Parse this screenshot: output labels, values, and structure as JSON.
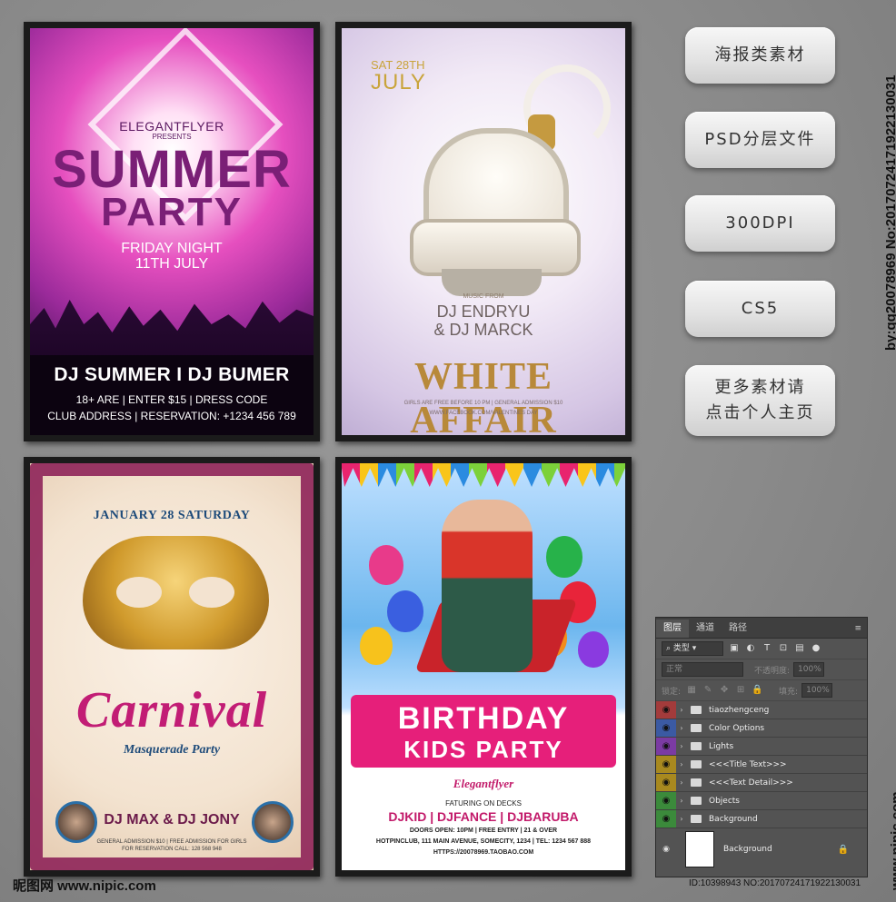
{
  "poster1": {
    "brand": "ELEGANTFLYER",
    "presents": "PRESENTS",
    "title1": "SUMMER",
    "title2": "PARTY",
    "date1": "FRIDAY NIGHT",
    "date2": "11TH JULY",
    "djs": "DJ SUMMER I DJ BUMER",
    "info1": "18+ ARE | ENTER $15 | DRESS CODE",
    "info2": "CLUB ADDRESS | RESERVATION: +1234 456 789"
  },
  "poster2": {
    "date_day": "SAT 28TH",
    "date_month": "JULY",
    "music_from": "MUSIC FROM",
    "dj1": "DJ ENDRYU",
    "dj2": "& DJ MARCK",
    "title": "WHITE AFFAIR",
    "small1": "GIRLS ARE FREE BEFORE 10 PM | GENERAL ADMISSION $10",
    "small2": "WWW.FACEBOOK.COM/VALENTINES DAY"
  },
  "poster3": {
    "date": "JANUARY 28 SATURDAY",
    "title": "Carnival",
    "subtitle": "Masquerade Party",
    "djs": "DJ MAX   &   DJ JONY",
    "info1": "GENERAL ADMISSION $10 | FREE ADMISSION FOR GIRLS",
    "info2": "FOR RESERVATION CALL: 128 568 948"
  },
  "poster4": {
    "title1": "BIRTHDAY",
    "title2": "KIDS PARTY",
    "brand": "Elegantflyer",
    "featuring": "FATURING ON DECKS",
    "djs": "DJKID | DJFANCE | DJBARUBA",
    "line1": "DOORS OPEN: 10PM | FREE ENTRY | 21 & OVER",
    "line2": "HOTPINCLUB, 111 MAIN AVENUE, SOMECITY, 1234 | TEL: 1234 567 888",
    "line3": "HTTPS://20078969.TAOBAO.COM"
  },
  "side_buttons": [
    {
      "label": "海报类素材"
    },
    {
      "label": "PSD分层文件"
    },
    {
      "label": "300DPI"
    },
    {
      "label": "CS5"
    },
    {
      "label": "更多素材请\n点击个人主页"
    }
  ],
  "vertical_credit": "by:qq20078969 No:20170724171922130031",
  "ps_panel": {
    "tabs": [
      "图层",
      "通道",
      "路径"
    ],
    "menu_icon": "≡",
    "filter_label": "类型",
    "blend_mode": "正常",
    "opacity_label": "不透明度:",
    "opacity_value": "100%",
    "lock_label": "锁定:",
    "fill_label": "填充:",
    "fill_value": "100%",
    "layers": [
      {
        "name": "tiaozhengceng",
        "color": "#a33b3b"
      },
      {
        "name": "Color Options",
        "color": "#3b5aa3"
      },
      {
        "name": "Lights",
        "color": "#7b3ba3"
      },
      {
        "name": "<<<Title Text>>>",
        "color": "#a8891f"
      },
      {
        "name": "<<<Text Detail>>>",
        "color": "#a8891f"
      },
      {
        "name": "Objects",
        "color": "#3b8a3b"
      },
      {
        "name": "Background",
        "color": "#3b8a3b"
      }
    ],
    "bg_layer": "Background"
  },
  "watermark_left": "昵图网 www.nipic.com",
  "watermark_id": "ID:10398943 NO:20170724171922130031",
  "watermark_right": "www.nipic.com"
}
